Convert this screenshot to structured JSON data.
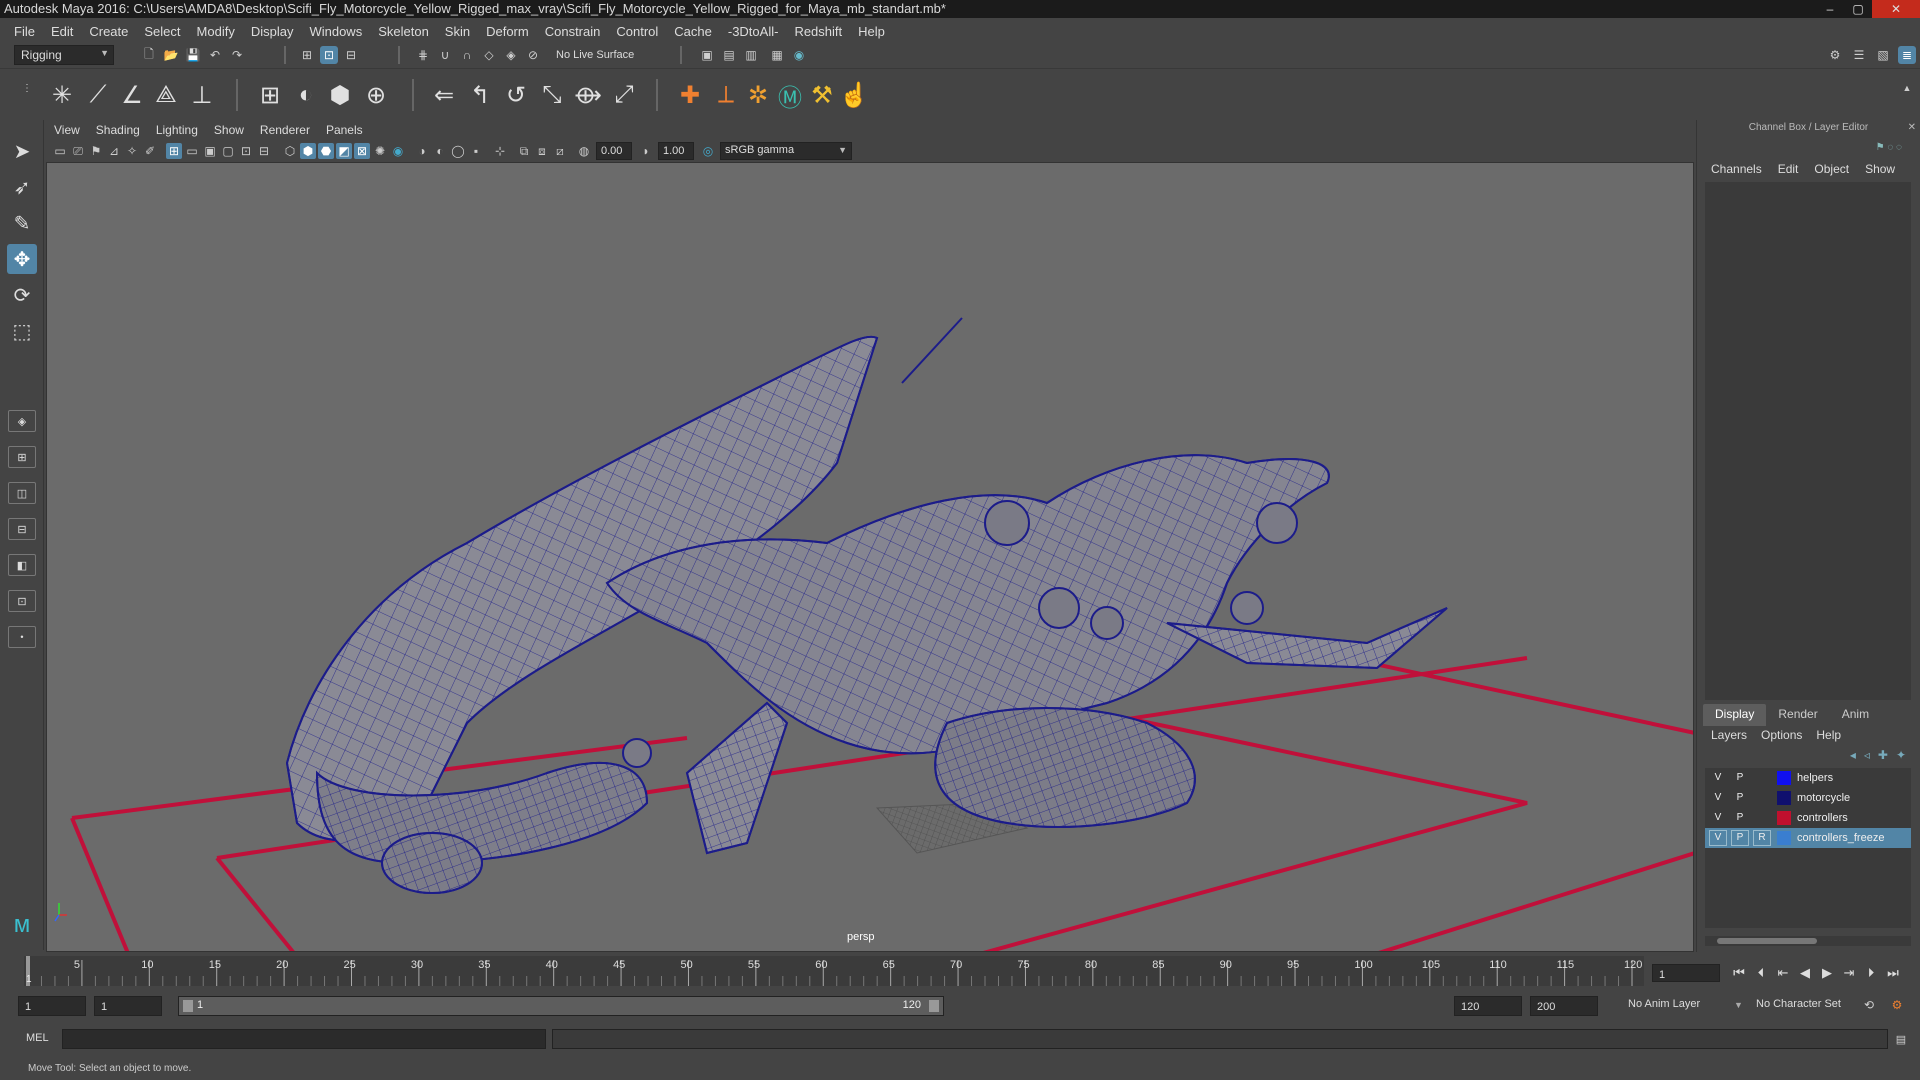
{
  "window": {
    "title": "Autodesk Maya 2016: C:\\Users\\AMDA8\\Desktop\\Scifi_Fly_Motorcycle_Yellow_Rigged_max_vray\\Scifi_Fly_Motorcycle_Yellow_Rigged_for_Maya_mb_standart.mb*",
    "minimize": "–",
    "maximize": "▢",
    "close": "✕"
  },
  "menubar": [
    "File",
    "Edit",
    "Create",
    "Select",
    "Modify",
    "Display",
    "Windows",
    "Skeleton",
    "Skin",
    "Deform",
    "Constrain",
    "Control",
    "Cache",
    "-3DtoAll-",
    "Redshift",
    "Help"
  ],
  "statusline": {
    "menuset": "Rigging",
    "live_surface": "No Live Surface"
  },
  "viewport": {
    "menu": [
      "View",
      "Shading",
      "Lighting",
      "Show",
      "Renderer",
      "Panels"
    ],
    "exposure": "0.00",
    "gamma": "1.00",
    "colorspace": "sRGB gamma",
    "camera": "persp"
  },
  "channelbox": {
    "title": "Channel Box / Layer Editor",
    "tabs": [
      "Channels",
      "Edit",
      "Object",
      "Show"
    ]
  },
  "layer_editor": {
    "tabs": [
      "Display",
      "Render",
      "Anim"
    ],
    "selected_tab": "Display",
    "menu": [
      "Layers",
      "Options",
      "Help"
    ],
    "layers": [
      {
        "v": "V",
        "p": "P",
        "r": "",
        "name": "helpers",
        "color": "#1010f0",
        "selected": false
      },
      {
        "v": "V",
        "p": "P",
        "r": "",
        "name": "motorcycle",
        "color": "#10106e",
        "selected": false
      },
      {
        "v": "V",
        "p": "P",
        "r": "",
        "name": "controllers",
        "color": "#c0102e",
        "selected": false
      },
      {
        "v": "V",
        "p": "P",
        "r": "R",
        "name": "controllers_freeze",
        "color": "#3a7ed0",
        "selected": true
      }
    ]
  },
  "timeline": {
    "ticks": [
      "5",
      "10",
      "15",
      "20",
      "25",
      "30",
      "35",
      "40",
      "45",
      "50",
      "55",
      "60",
      "65",
      "70",
      "75",
      "80",
      "85",
      "90",
      "95",
      "100",
      "105",
      "110",
      "115",
      "120"
    ],
    "start_label": "1",
    "current_frame": "1"
  },
  "range": {
    "start": "1",
    "playback_start": "1",
    "range_start_label": "1",
    "range_end_label": "120",
    "playback_end": "120",
    "end": "200",
    "anim_layer": "No Anim Layer",
    "character_set": "No Character Set"
  },
  "cmdline": {
    "language": "MEL"
  },
  "help": "Move Tool: Select an object to move."
}
